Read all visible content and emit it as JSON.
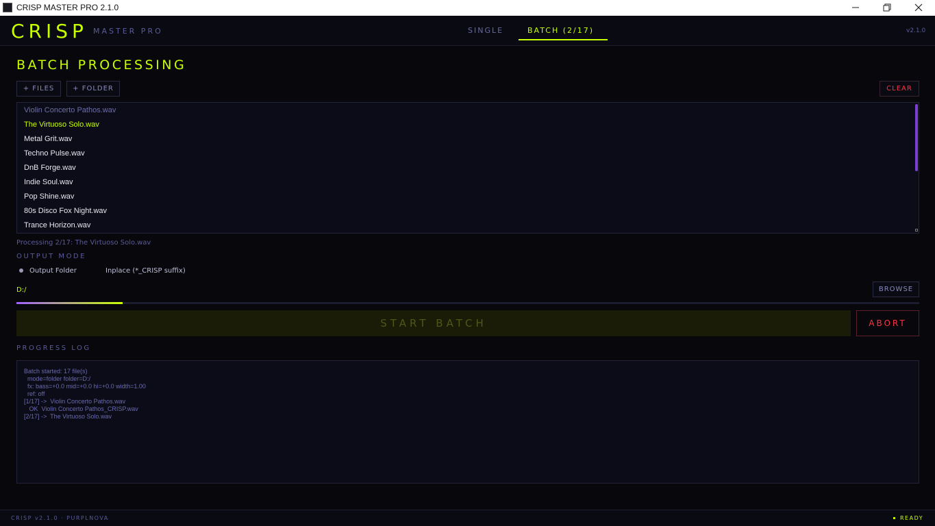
{
  "window": {
    "title": "CRISP MASTER PRO 2.1.0",
    "controls": [
      "minimize-icon",
      "maximize-icon",
      "close-icon"
    ]
  },
  "header": {
    "logo": "CRISP",
    "subtitle": "MASTER PRO",
    "tabs": [
      {
        "label": "SINGLE",
        "active": false
      },
      {
        "label": "BATCH (2/17)",
        "active": true
      }
    ],
    "version": "v2.1.0"
  },
  "batch": {
    "title": "BATCH PROCESSING",
    "add_files_label": "+ FILES",
    "add_folder_label": "+ FOLDER",
    "clear_label": "CLEAR",
    "files": [
      {
        "name": "Violin Concerto Pathos.wav",
        "state": "done"
      },
      {
        "name": "The Virtuoso Solo.wav",
        "state": "active"
      },
      {
        "name": "Metal Grit.wav",
        "state": "pending"
      },
      {
        "name": "Techno Pulse.wav",
        "state": "pending"
      },
      {
        "name": "DnB Forge.wav",
        "state": "pending"
      },
      {
        "name": "Indie Soul.wav",
        "state": "pending"
      },
      {
        "name": "Pop Shine.wav",
        "state": "pending"
      },
      {
        "name": "80s Disco Fox Night.wav",
        "state": "pending"
      },
      {
        "name": "Trance Horizon.wav",
        "state": "pending"
      }
    ],
    "status": "Processing 2/17: The Virtuoso Solo.wav",
    "output_mode_label": "OUTPUT MODE",
    "output_options": [
      {
        "label": "Output Folder",
        "selected": true
      },
      {
        "label": "Inplace (*_CRISP suffix)",
        "selected": false
      }
    ],
    "folder_path": "D:/",
    "browse_label": "BROWSE",
    "progress_fraction": 0.1176,
    "start_label": "START BATCH",
    "abort_label": "ABORT",
    "log_label": "PROGRESS LOG",
    "log_lines": [
      "Batch started: 17 file(s)",
      "  mode=folder folder=D:/",
      "  fx: bass=+0.0 mid=+0.0 hi=+0.0 width=1.00",
      "  ref: off",
      "[1/17] ->  Violin Concerto Pathos.wav",
      "   OK  Violin Concerto Pathos_CRISP.wav",
      "[2/17] ->  The Virtuoso Solo.wav"
    ]
  },
  "footer": {
    "left": "CRISP v2.1.0  ·  PURPLNOVA",
    "status": "READY"
  },
  "colors": {
    "accent": "#c8ff00",
    "muted": "#5b5b9a",
    "danger": "#ff3344",
    "scroll": "#7a3fd0",
    "background": "#07070c"
  }
}
